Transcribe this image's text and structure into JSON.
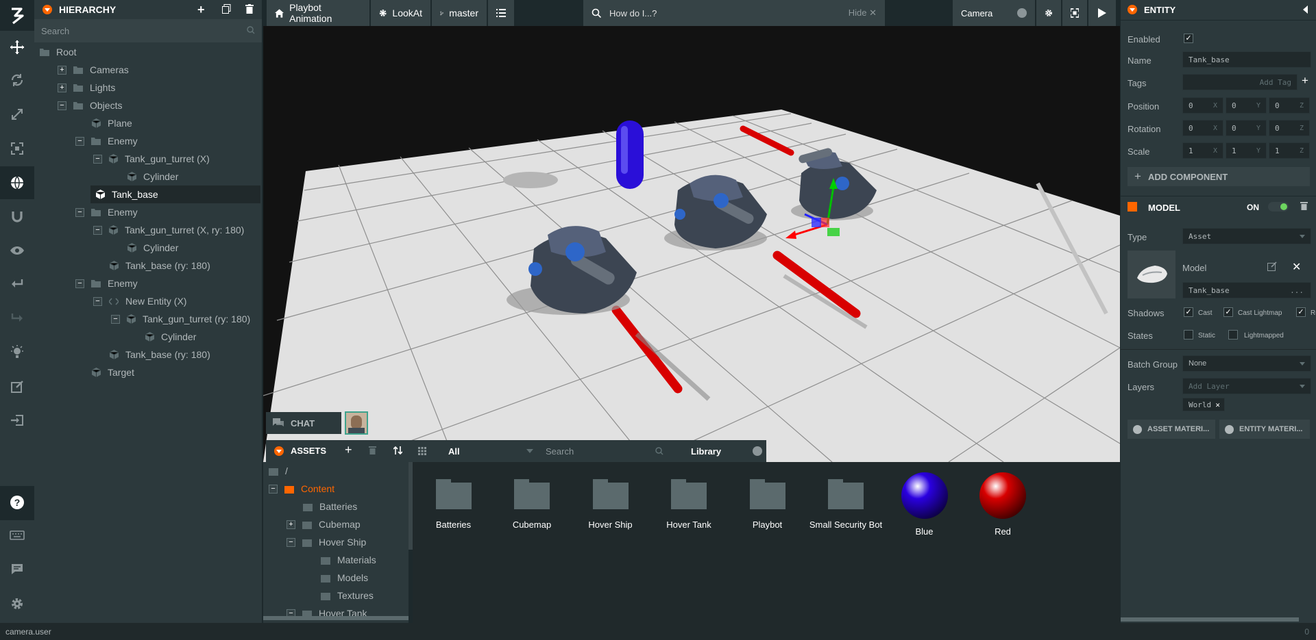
{
  "toolbar": {
    "icons": [
      "logo-icon",
      "move-icon",
      "rotate-icon",
      "scale-icon",
      "resize-icon",
      "world-icon",
      "magnet-icon",
      "eye-icon",
      "undo-icon",
      "redo-icon",
      "light-icon",
      "edit-icon",
      "publish-icon",
      "help-icon",
      "keyboard-icon",
      "chat-icon",
      "settings-icon"
    ]
  },
  "hierarchy": {
    "title": "HIERARCHY",
    "search_placeholder": "Search",
    "items": [
      {
        "label": "Root",
        "toggle": ""
      },
      {
        "label": "Cameras",
        "toggle": "+"
      },
      {
        "label": "Lights",
        "toggle": "+"
      },
      {
        "label": "Objects",
        "toggle": "−"
      },
      {
        "label": "Plane",
        "toggle": ""
      },
      {
        "label": "Enemy",
        "toggle": "−"
      },
      {
        "label": "Tank_gun_turret (X)",
        "toggle": "−"
      },
      {
        "label": "Cylinder",
        "toggle": ""
      },
      {
        "label": "Tank_base",
        "toggle": ""
      },
      {
        "label": "Enemy",
        "toggle": "−"
      },
      {
        "label": "Tank_gun_turret (X, ry: 180)",
        "toggle": "−"
      },
      {
        "label": "Cylinder",
        "toggle": ""
      },
      {
        "label": "Tank_base (ry: 180)",
        "toggle": ""
      },
      {
        "label": "Enemy",
        "toggle": "−"
      },
      {
        "label": "New Entity (X)",
        "toggle": "−"
      },
      {
        "label": "Tank_gun_turret (ry: 180)",
        "toggle": "−"
      },
      {
        "label": "Cylinder",
        "toggle": ""
      },
      {
        "label": "Tank_base (ry: 180)",
        "toggle": ""
      },
      {
        "label": "Target",
        "toggle": ""
      }
    ]
  },
  "topbar": {
    "project": "Playbot Animation",
    "scene": "LookAt",
    "branch": "master",
    "search_placeholder": "How do I...?",
    "hide": "Hide",
    "camera": "Camera"
  },
  "chat": {
    "label": "CHAT"
  },
  "assets": {
    "title": "ASSETS",
    "filter": "All",
    "search_placeholder": "Search",
    "library": "Library",
    "tree": [
      {
        "label": "/",
        "toggle": ""
      },
      {
        "label": "Content",
        "toggle": "−"
      },
      {
        "label": "Batteries",
        "toggle": ""
      },
      {
        "label": "Cubemap",
        "toggle": "+"
      },
      {
        "label": "Hover Ship",
        "toggle": "−"
      },
      {
        "label": "Materials",
        "toggle": ""
      },
      {
        "label": "Models",
        "toggle": ""
      },
      {
        "label": "Textures",
        "toggle": ""
      },
      {
        "label": "Hover Tank",
        "toggle": "−"
      }
    ],
    "items": [
      {
        "label": "Batteries",
        "kind": "folder"
      },
      {
        "label": "Cubemap",
        "kind": "folder"
      },
      {
        "label": "Hover Ship",
        "kind": "folder"
      },
      {
        "label": "Hover Tank",
        "kind": "folder"
      },
      {
        "label": "Playbot",
        "kind": "folder"
      },
      {
        "label": "Small Security Bot",
        "kind": "folder"
      },
      {
        "label": "Blue",
        "kind": "material",
        "color": "#2a00e0"
      },
      {
        "label": "Red",
        "kind": "material",
        "color": "#d80000"
      }
    ]
  },
  "inspector": {
    "title": "ENTITY",
    "enabled_label": "Enabled",
    "name_label": "Name",
    "name_value": "Tank_base",
    "tags_label": "Tags",
    "tags_placeholder": "Add Tag",
    "position_label": "Position",
    "position": [
      "0",
      "0",
      "0"
    ],
    "rotation_label": "Rotation",
    "rotation": [
      "0",
      "0",
      "0"
    ],
    "scale_label": "Scale",
    "scale": [
      "1",
      "1",
      "1"
    ],
    "axes": [
      "X",
      "Y",
      "Z"
    ],
    "add_component": "ADD COMPONENT",
    "model": {
      "title": "MODEL",
      "on": "ON",
      "type_label": "Type",
      "type_value": "Asset",
      "model_label": "Model",
      "model_value": "Tank_base",
      "model_more": "...",
      "shadows_label": "Shadows",
      "cast": "Cast",
      "cast_lightmap": "Cast Lightmap",
      "receive": "Re",
      "states_label": "States",
      "static": "Static",
      "lightmapped": "Lightmapped",
      "batch_label": "Batch Group",
      "batch_value": "None",
      "layers_label": "Layers",
      "layers_placeholder": "Add Layer",
      "layer_tag": "World",
      "asset_materials": "ASSET MATERI...",
      "entity_materials": "ENTITY MATERI..."
    }
  },
  "colors": {
    "accent": "#ff6600",
    "panel": "#2c393c",
    "dark": "#20292b",
    "plane": "#e0e0e0"
  },
  "status": {
    "text": "camera.user",
    "count": "0"
  }
}
